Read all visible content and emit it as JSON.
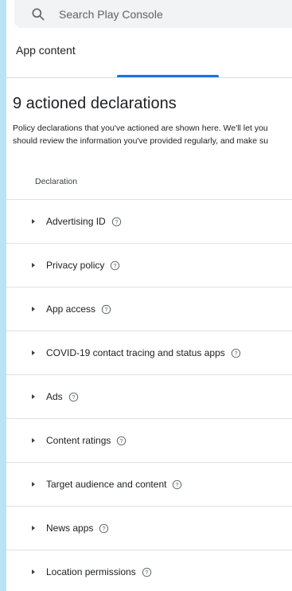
{
  "search": {
    "placeholder": "Search Play Console",
    "icon": "search-icon"
  },
  "header": {
    "app_content": "App content"
  },
  "accent": "#1a73e8",
  "section": {
    "title": "9 actioned declarations",
    "desc_line1": "Policy declarations that you've actioned are shown here. We'll let you",
    "desc_line2": "should review the information you've provided regularly, and make su"
  },
  "table": {
    "column": "Declaration",
    "rows": [
      {
        "label": "Advertising ID"
      },
      {
        "label": "Privacy policy"
      },
      {
        "label": "App access"
      },
      {
        "label": "COVID-19 contact tracing and status apps"
      },
      {
        "label": "Ads"
      },
      {
        "label": "Content ratings"
      },
      {
        "label": "Target audience and content"
      },
      {
        "label": "News apps"
      },
      {
        "label": "Location permissions"
      }
    ]
  }
}
